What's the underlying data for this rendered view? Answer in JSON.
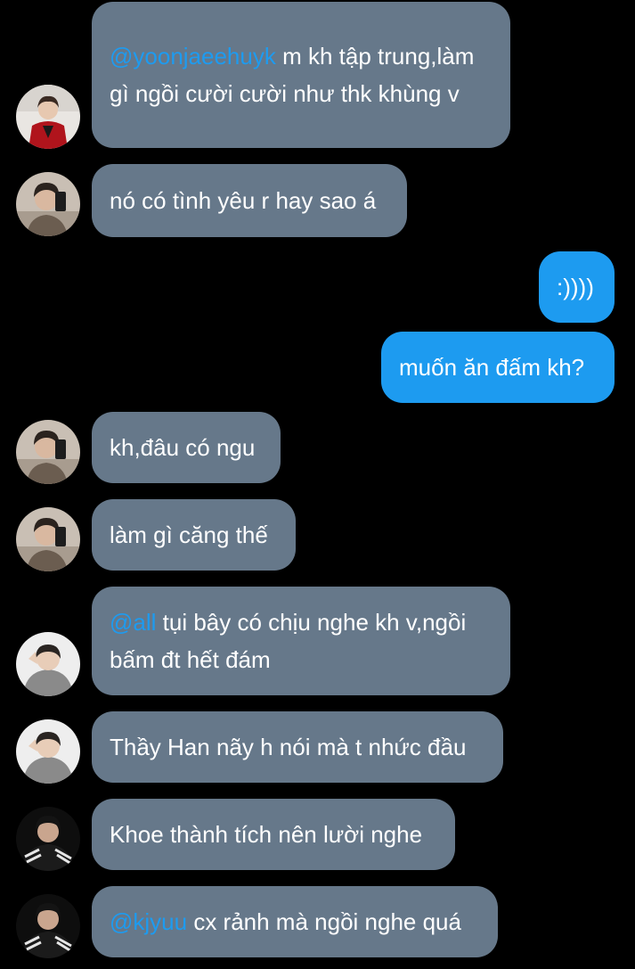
{
  "colors": {
    "background": "#000000",
    "incoming_bubble": "#66788a",
    "outgoing_bubble": "#1d9bf0",
    "mention": "#1d9bf0",
    "text": "#ffffff"
  },
  "messages": [
    {
      "dir": "in",
      "avatar": "avatar-red-jacket",
      "mention": "@yoonjaeehuyk",
      "text": " m kh tập trung,làm gì ngồi cười cười như thk khùng v"
    },
    {
      "dir": "in",
      "avatar": "avatar-mirror-selfie",
      "mention": "",
      "text": "nó có tình yêu r hay sao á"
    },
    {
      "dir": "out",
      "avatar": "",
      "mention": "",
      "text": ":))))"
    },
    {
      "dir": "out",
      "avatar": "",
      "mention": "",
      "text": "muốn ăn đấm kh?"
    },
    {
      "dir": "in",
      "avatar": "avatar-mirror-selfie",
      "mention": "",
      "text": "kh,đâu có ngu"
    },
    {
      "dir": "in",
      "avatar": "avatar-mirror-selfie",
      "mention": "",
      "text": "làm gì căng thế"
    },
    {
      "dir": "in",
      "avatar": "avatar-grey-hoodie",
      "mention": "@all",
      "text": " tụi bây có chịu nghe kh v,ngồi bấm đt hết đám"
    },
    {
      "dir": "in",
      "avatar": "avatar-grey-hoodie",
      "mention": "",
      "text": "Thầy Han nãy h nói mà t nhức đầu"
    },
    {
      "dir": "in",
      "avatar": "avatar-black-tracksuit",
      "mention": "",
      "text": "Khoe thành tích nên lười nghe"
    },
    {
      "dir": "in",
      "avatar": "avatar-black-tracksuit",
      "mention": "@kjyuu",
      "text": " cx rảnh mà ngồi nghe quá"
    }
  ]
}
